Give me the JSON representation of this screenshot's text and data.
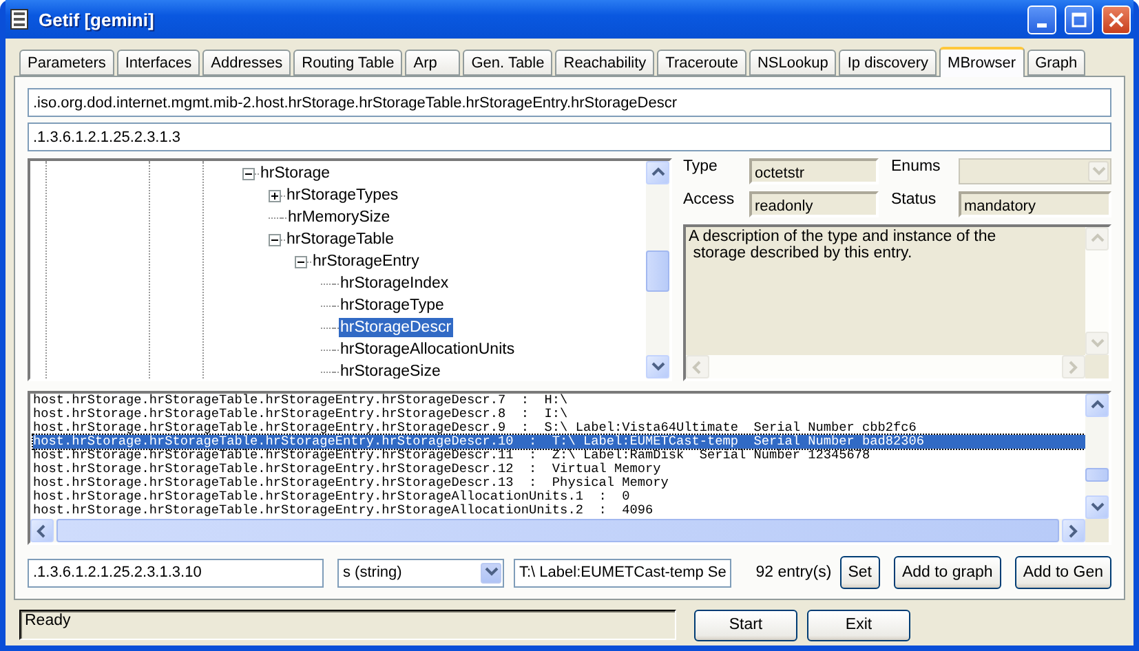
{
  "window": {
    "title": "Getif [gemini]"
  },
  "tabs": [
    {
      "label": "Parameters",
      "selected": false
    },
    {
      "label": "Interfaces",
      "selected": false
    },
    {
      "label": "Addresses",
      "selected": false
    },
    {
      "label": "Routing Table",
      "selected": false
    },
    {
      "label": "Arp",
      "selected": false
    },
    {
      "label": "Gen. Table",
      "selected": false
    },
    {
      "label": "Reachability",
      "selected": false
    },
    {
      "label": "Traceroute",
      "selected": false
    },
    {
      "label": "NSLookup",
      "selected": false
    },
    {
      "label": "Ip discovery",
      "selected": false
    },
    {
      "label": "MBrowser",
      "selected": true
    },
    {
      "label": "Graph",
      "selected": false
    }
  ],
  "oid_name": {
    "value": ".iso.org.dod.internet.mgmt.mib-2.host.hrStorage.hrStorageTable.hrStorageEntry.hrStorageDescr"
  },
  "oid_number": {
    "value": ".1.3.6.1.2.1.25.2.3.1.3"
  },
  "mib_tree": [
    {
      "label": "hrStorage",
      "expanded": true,
      "selected": false,
      "children": [
        {
          "label": "hrStorageTypes",
          "expanded": false,
          "selected": false
        },
        {
          "label": "hrMemorySize",
          "selected": false
        },
        {
          "label": "hrStorageTable",
          "expanded": true,
          "selected": false,
          "children": [
            {
              "label": "hrStorageEntry",
              "expanded": true,
              "selected": false,
              "children": [
                {
                  "label": "hrStorageIndex",
                  "selected": false
                },
                {
                  "label": "hrStorageType",
                  "selected": false
                },
                {
                  "label": "hrStorageDescr",
                  "selected": true
                },
                {
                  "label": "hrStorageAllocationUnits",
                  "selected": false
                },
                {
                  "label": "hrStorageSize",
                  "selected": false
                }
              ]
            }
          ]
        }
      ]
    }
  ],
  "properties": {
    "type_label": "Type",
    "type_value": "octetstr",
    "enums_label": "Enums",
    "access_label": "Access",
    "access_value": "readonly",
    "status_label": "Status",
    "status_value": "mandatory"
  },
  "description": "A description of the type and instance of the\n storage described by this entry.",
  "results": [
    {
      "text": "host.hrStorage.hrStorageTable.hrStorageEntry.hrStorageDescr.7  :  H:\\",
      "selected": false
    },
    {
      "text": "host.hrStorage.hrStorageTable.hrStorageEntry.hrStorageDescr.8  :  I:\\",
      "selected": false
    },
    {
      "text": "host.hrStorage.hrStorageTable.hrStorageEntry.hrStorageDescr.9  :  S:\\ Label:Vista64Ultimate  Serial Number cbb2fc6",
      "selected": false
    },
    {
      "text": "host.hrStorage.hrStorageTable.hrStorageEntry.hrStorageDescr.10  :  T:\\ Label:EUMETCast-temp  Serial Number bad82306",
      "selected": true
    },
    {
      "text": "host.hrStorage.hrStorageTable.hrStorageEntry.hrStorageDescr.11  :  Z:\\ Label:RamDisk  Serial Number 12345678",
      "selected": false
    },
    {
      "text": "host.hrStorage.hrStorageTable.hrStorageEntry.hrStorageDescr.12  :  Virtual Memory",
      "selected": false
    },
    {
      "text": "host.hrStorage.hrStorageTable.hrStorageEntry.hrStorageDescr.13  :  Physical Memory",
      "selected": false
    },
    {
      "text": "host.hrStorage.hrStorageTable.hrStorageEntry.hrStorageAllocationUnits.1  :  0",
      "selected": false
    },
    {
      "text": "host.hrStorage.hrStorageTable.hrStorageEntry.hrStorageAllocationUnits.2  :  4096",
      "selected": false
    }
  ],
  "set_form": {
    "oid": ".1.3.6.1.2.1.25.2.3.1.3.10",
    "type": "s (string)",
    "value": "T:\\ Label:EUMETCast-temp  Se"
  },
  "entry_count": "92 entry(s)",
  "actions": [
    "Set",
    "Add to graph",
    "Add to Gen"
  ],
  "status_bar": {
    "text": "Ready"
  },
  "footer_buttons": [
    "Start",
    "Exit"
  ]
}
